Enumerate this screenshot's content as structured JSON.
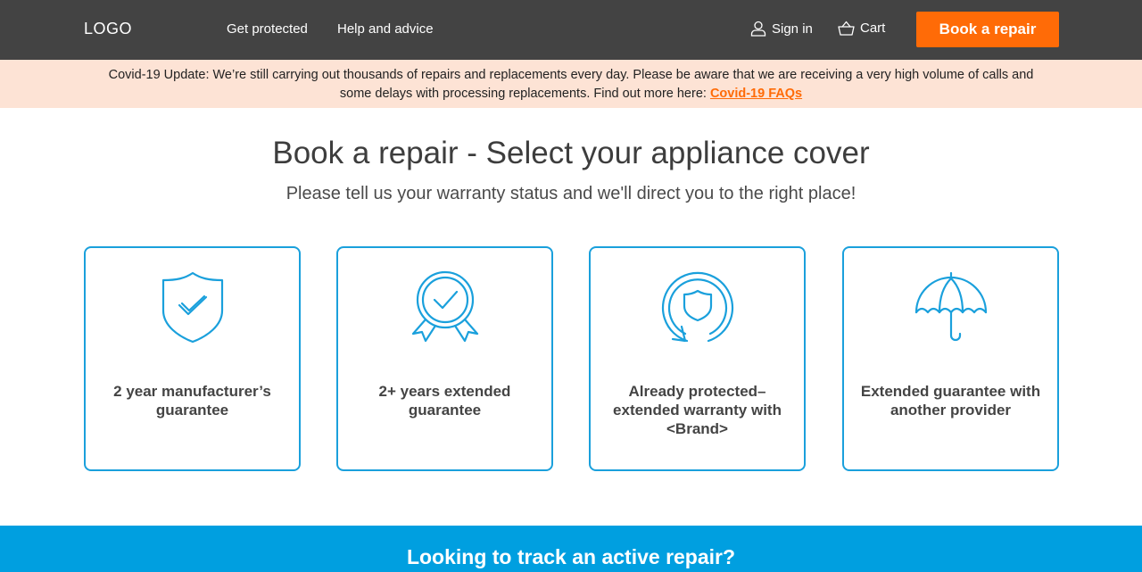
{
  "header": {
    "logo": "LOGO",
    "nav": [
      {
        "label": "Get protected"
      },
      {
        "label": "Help and advice"
      }
    ],
    "sign_in": {
      "label": "Sign in",
      "icon": "user-icon"
    },
    "cart": {
      "label": "Cart",
      "icon": "basket-icon"
    },
    "book_button": "Book a repair"
  },
  "banner": {
    "line1": "Covid-19 Update: We’re still carrying out thousands of repairs and replacements every day. Please be aware that we are receiving a very high volume of calls and",
    "line2": "some delays with processing replacements. Find out more here: ",
    "link": "Covid-19 FAQs"
  },
  "main": {
    "title": "Book a repair - Select your appliance cover",
    "subtitle": "Please tell us your warranty status and we'll direct you to the right place!",
    "cards": [
      {
        "label": "2 year manufacturer’s guarantee",
        "icon": "shield-check-icon"
      },
      {
        "label": "2+ years extended guarantee",
        "icon": "award-badge-icon"
      },
      {
        "label": "Already protected–extended warranty with <Brand>",
        "icon": "renew-shield-icon"
      },
      {
        "label": "Extended guarantee with another provider",
        "icon": "umbrella-icon"
      }
    ]
  },
  "track": {
    "title": "Looking to track an active repair?"
  },
  "colors": {
    "header_bg": "#434343",
    "accent": "#ff6b07",
    "banner_bg": "#fde3d5",
    "card_border": "#1aa0dc",
    "track_bg": "#009fe0"
  }
}
